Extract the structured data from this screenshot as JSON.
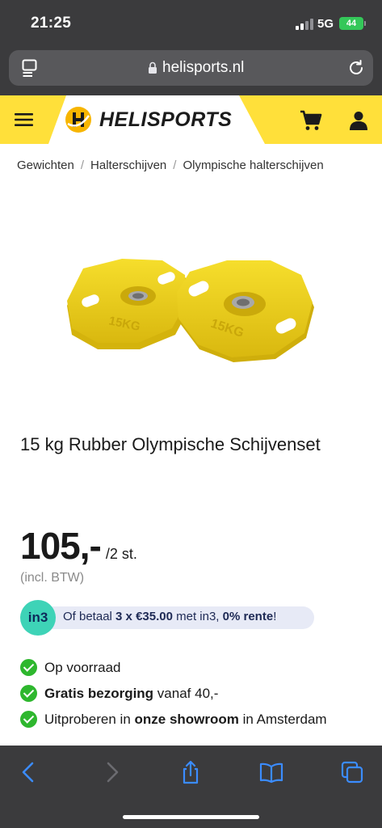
{
  "status_bar": {
    "time": "21:25",
    "network": "5G",
    "battery": "44"
  },
  "browser": {
    "url": "helisports.nl"
  },
  "site": {
    "logo_text": "HELISPORTS",
    "brand_color": "#ffe03a"
  },
  "breadcrumb": {
    "items": [
      "Gewichten",
      "Halterschijven",
      "Olympische halterschijven"
    ],
    "separator": "/"
  },
  "product": {
    "title": "15 kg Rubber Olympische Schijvenset",
    "price": "105,-",
    "price_unit": "/2 st.",
    "vat_note": "(incl. BTW)",
    "plate_label": "15KG",
    "plate_color": "#f2d21a"
  },
  "financing": {
    "logo": "in3",
    "text_prefix": "Of betaal ",
    "text_bold_1": "3 x €35.00",
    "text_middle": " met in3, ",
    "text_bold_2": "0% rente",
    "text_suffix": "!"
  },
  "usps": [
    {
      "bold": "",
      "text": "Op voorraad",
      "bold_after": "",
      "suffix": ""
    },
    {
      "bold": "Gratis bezorging",
      "text": " vanaf 40,-",
      "bold_after": "",
      "suffix": ""
    },
    {
      "bold": "",
      "text": "Uitproberen in ",
      "bold_after": "onze showroom",
      "suffix": " in Amsterdam"
    }
  ],
  "toolbar": {
    "icons": [
      "back-icon",
      "forward-icon",
      "share-icon",
      "bookmarks-icon",
      "tabs-icon"
    ]
  }
}
